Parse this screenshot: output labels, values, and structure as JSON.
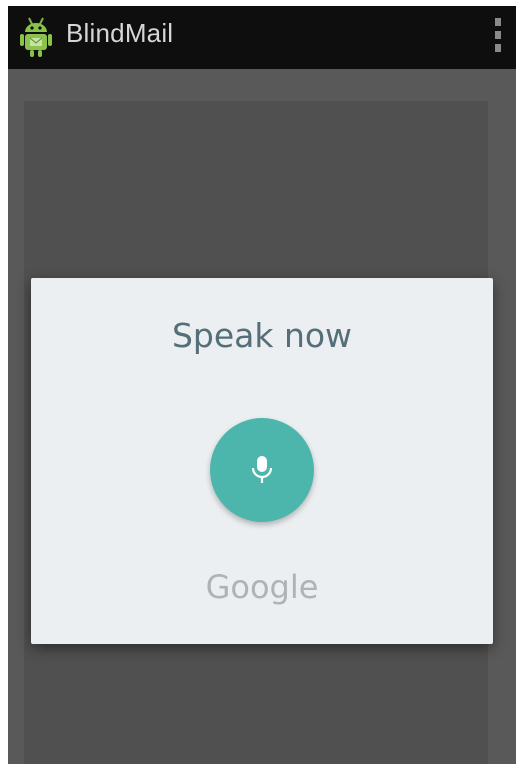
{
  "status_bar": {
    "app_title": "BlindMail",
    "app_icon": "android-robot-icon",
    "menu_icon": "overflow-menu-icon"
  },
  "voice_dialog": {
    "title": "Speak now",
    "mic_icon": "microphone-icon",
    "brand": "Google"
  },
  "colors": {
    "action_bar": "#0e0e0e",
    "background_dim": "#595959",
    "dialog_bg": "#eceff1",
    "title_text": "#546e7a",
    "mic_accent": "#4db6ac",
    "brand_text": "#b0b3b5"
  }
}
